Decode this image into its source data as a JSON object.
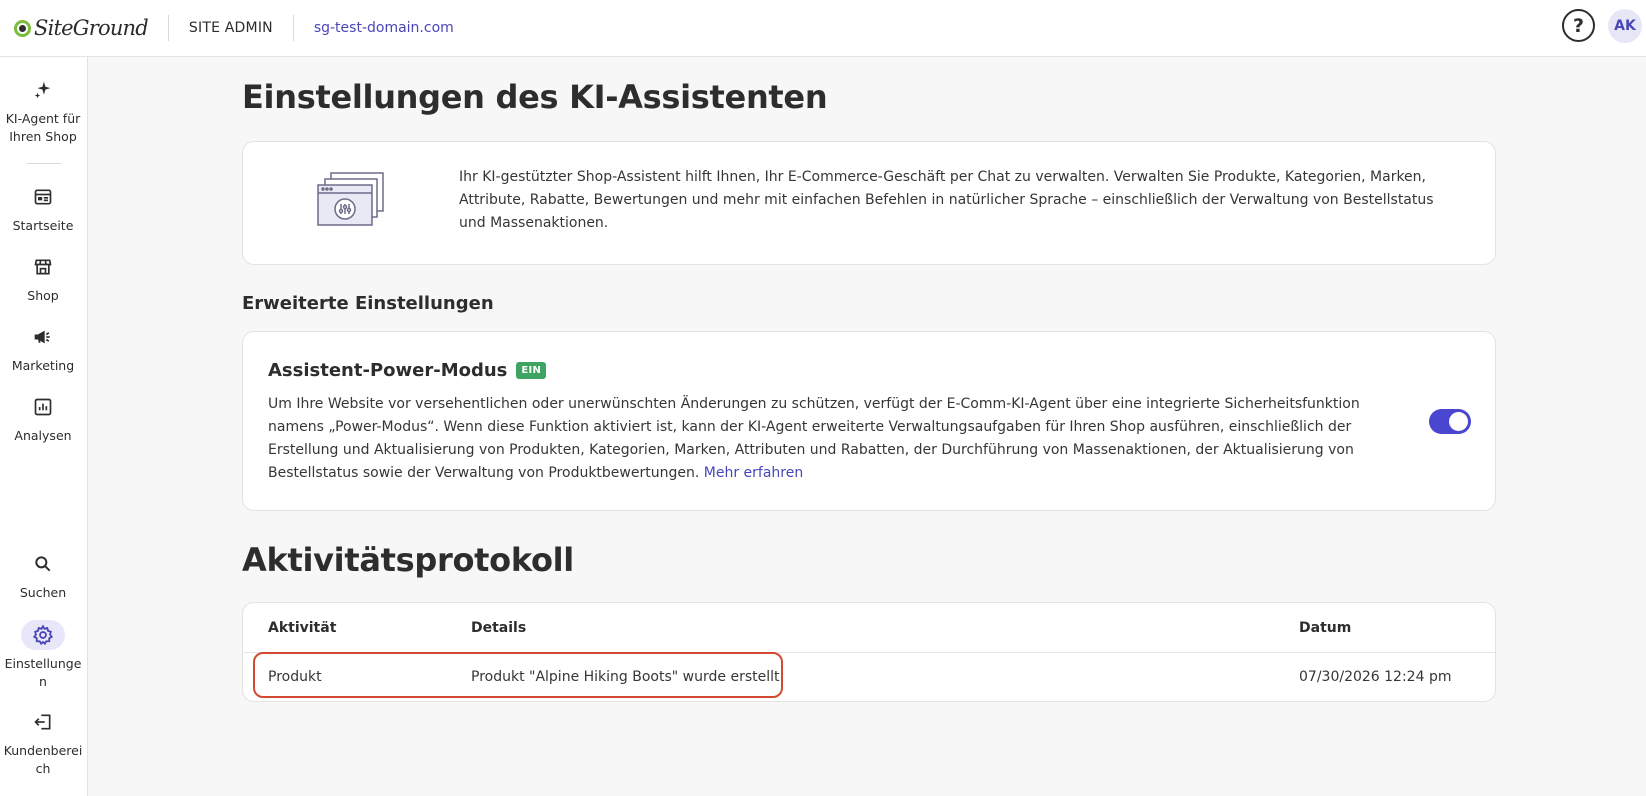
{
  "header": {
    "logo_text": "SiteGround",
    "section": "SITE ADMIN",
    "domain": "sg-test-domain.com",
    "help_symbol": "?",
    "avatar_initials": "AK"
  },
  "sidebar": {
    "items": [
      {
        "label": "KI-Agent für Ihren Shop",
        "icon": "sparkle-icon"
      },
      {
        "label": "Startseite",
        "icon": "dashboard-icon"
      },
      {
        "label": "Shop",
        "icon": "store-icon"
      },
      {
        "label": "Marketing",
        "icon": "megaphone-icon"
      },
      {
        "label": "Analysen",
        "icon": "chart-icon"
      },
      {
        "label": "Suchen",
        "icon": "search-icon"
      },
      {
        "label": "Einstellungen",
        "icon": "gear-icon"
      },
      {
        "label": "Kundenbereich",
        "icon": "exit-icon"
      }
    ],
    "active_color": "#4a46b8"
  },
  "main": {
    "title": "Einstellungen des KI-Assistenten",
    "intro": "Ihr KI-gestützter Shop-Assistent hilft Ihnen, Ihr E-Commerce-Geschäft per Chat zu verwalten. Verwalten Sie Produkte, Kategorien, Marken, Attribute, Rabatte, Bewertungen und mehr mit einfachen Befehlen in natürlicher Sprache – einschließlich der Verwaltung von Bestellstatus und Massenaktionen.",
    "advanced_heading": "Erweiterte Einstellungen",
    "power_mode": {
      "title": "Assistent-Power-Modus",
      "badge": "EIN",
      "description": "Um Ihre Website vor versehentlichen oder unerwünschten Änderungen zu schützen, verfügt der E-Comm-KI-Agent über eine integrierte Sicherheitsfunktion namens „Power-Modus“. Wenn diese Funktion aktiviert ist, kann der KI-Agent erweiterte Verwaltungsaufgaben für Ihren Shop ausführen, einschließlich der Erstellung und Aktualisierung von Produkten, Kategorien, Marken, Attributen und Rabatten, der Durchführung von Massenaktionen, der Aktualisierung von Bestellstatus sowie der Verwaltung von Produktbewertungen.",
      "link": "Mehr erfahren",
      "enabled": true
    },
    "activity_heading": "Aktivitätsprotokoll",
    "activity_table": {
      "columns": [
        "Aktivität",
        "Details",
        "Datum"
      ],
      "rows": [
        {
          "activity": "Produkt",
          "details": "Produkt \"Alpine Hiking Boots\" wurde erstellt.",
          "date": "07/30/2026 12:24 pm"
        }
      ]
    }
  },
  "colors": {
    "accent": "#4a46cf",
    "badge": "#3fa461",
    "highlight": "#d24a32",
    "logo_green": "#7bbd3a"
  }
}
